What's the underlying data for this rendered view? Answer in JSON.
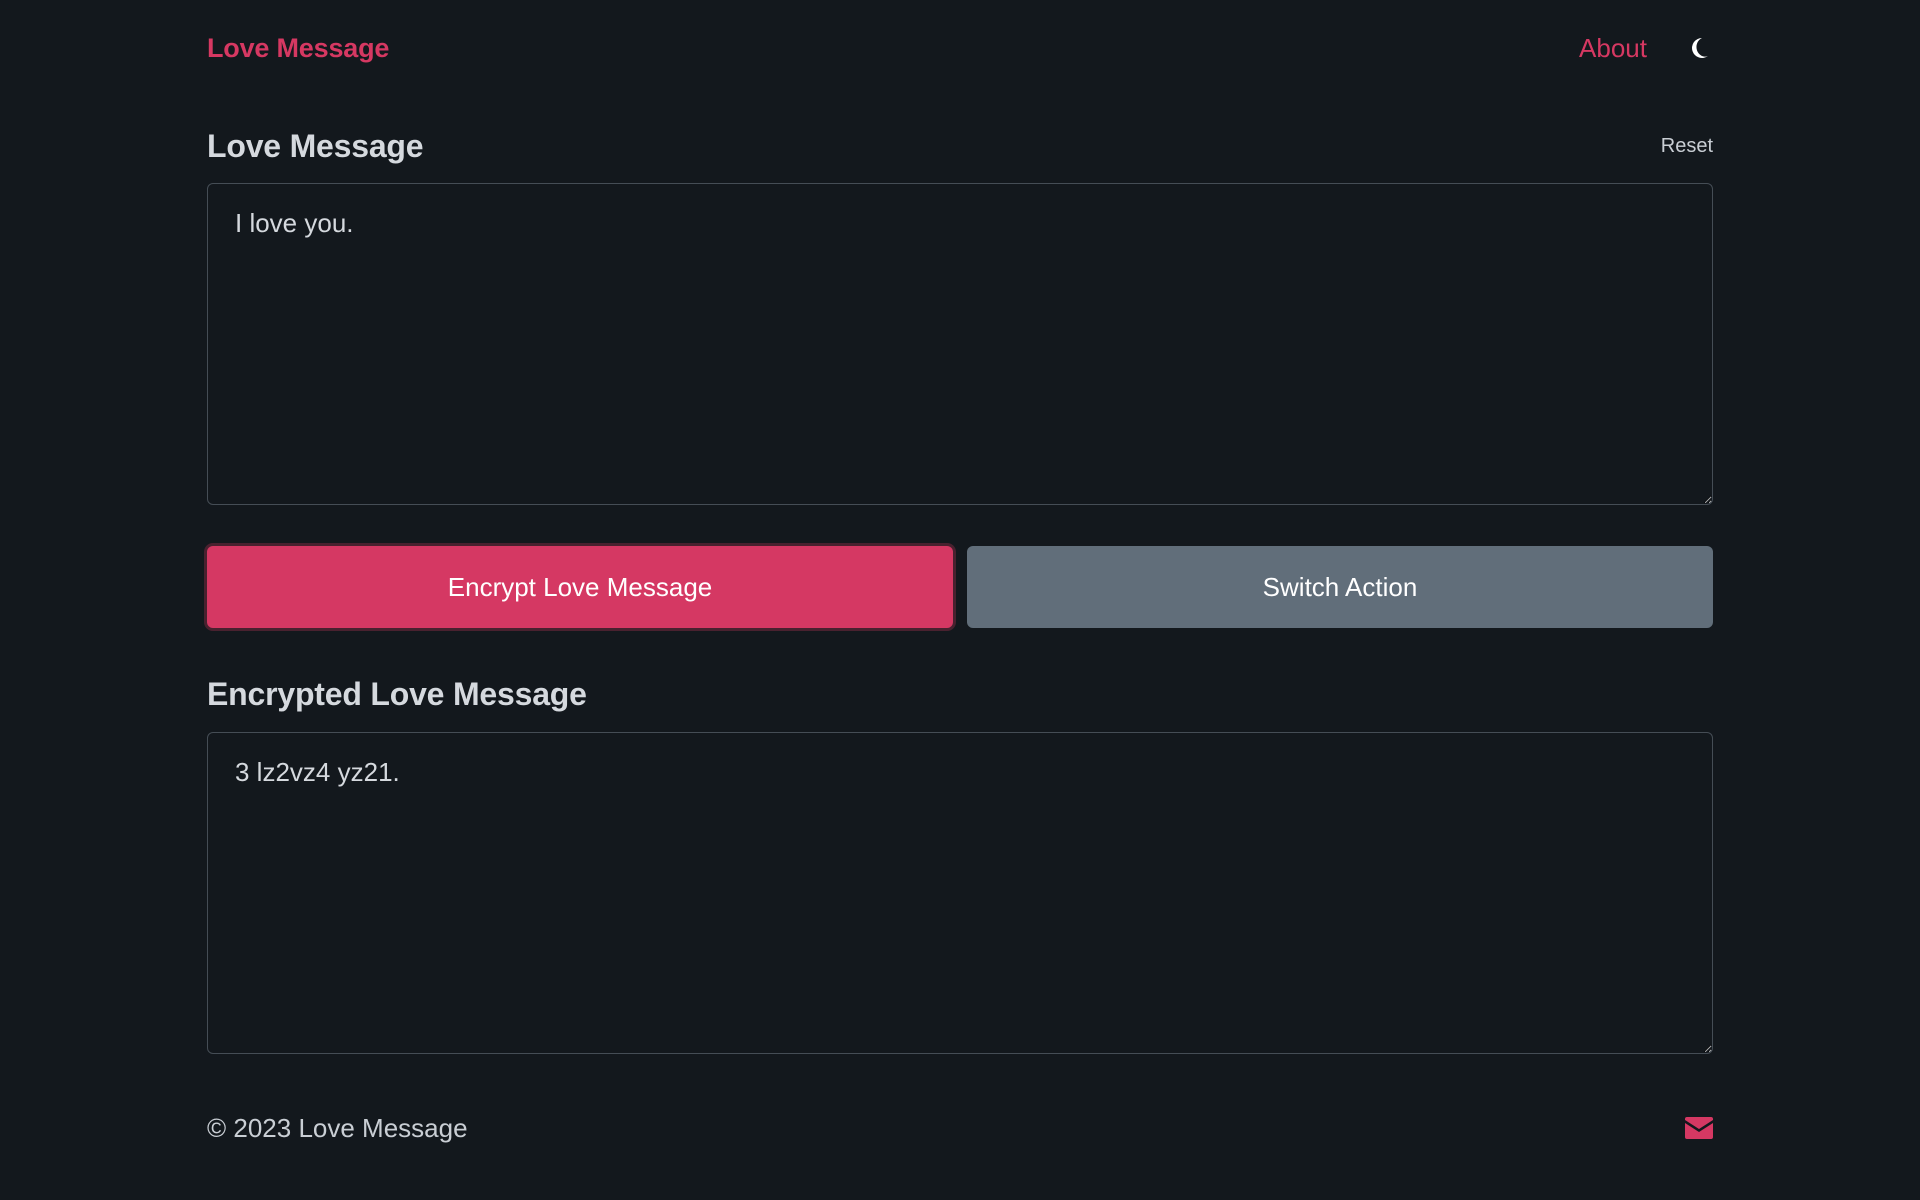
{
  "navbar": {
    "brand": "Love Message",
    "about": "About",
    "theme_icon": "moon-icon"
  },
  "input_section": {
    "title": "Love Message",
    "reset": "Reset",
    "value": "I love you."
  },
  "actions": {
    "encrypt": "Encrypt Love Message",
    "switch": "Switch Action"
  },
  "output_section": {
    "title": "Encrypted Love Message",
    "value": "3 lz2vz4 yz21."
  },
  "footer": {
    "copyright": "© 2023 Love Message",
    "mail_icon": "envelope-icon"
  },
  "colors": {
    "accent": "#d53863",
    "secondary": "#616e7a",
    "background": "#13181d"
  }
}
